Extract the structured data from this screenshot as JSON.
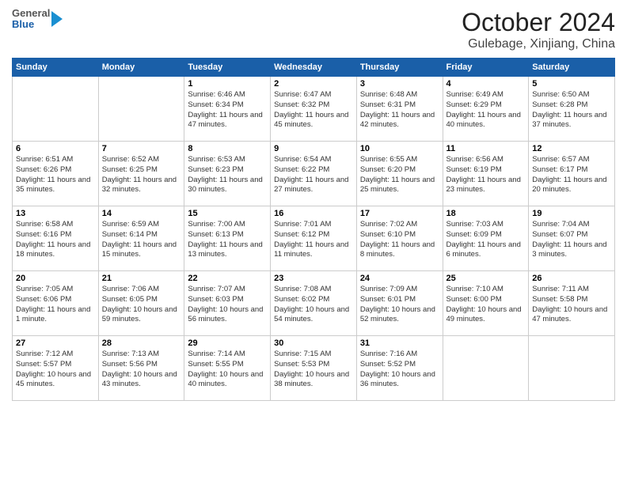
{
  "header": {
    "logo": {
      "general": "General",
      "blue": "Blue"
    },
    "title": "October 2024",
    "location": "Gulebage, Xinjiang, China"
  },
  "weekdays": [
    "Sunday",
    "Monday",
    "Tuesday",
    "Wednesday",
    "Thursday",
    "Friday",
    "Saturday"
  ],
  "weeks": [
    [
      {
        "day": "",
        "info": ""
      },
      {
        "day": "",
        "info": ""
      },
      {
        "day": "1",
        "info": "Sunrise: 6:46 AM\nSunset: 6:34 PM\nDaylight: 11 hours and 47 minutes."
      },
      {
        "day": "2",
        "info": "Sunrise: 6:47 AM\nSunset: 6:32 PM\nDaylight: 11 hours and 45 minutes."
      },
      {
        "day": "3",
        "info": "Sunrise: 6:48 AM\nSunset: 6:31 PM\nDaylight: 11 hours and 42 minutes."
      },
      {
        "day": "4",
        "info": "Sunrise: 6:49 AM\nSunset: 6:29 PM\nDaylight: 11 hours and 40 minutes."
      },
      {
        "day": "5",
        "info": "Sunrise: 6:50 AM\nSunset: 6:28 PM\nDaylight: 11 hours and 37 minutes."
      }
    ],
    [
      {
        "day": "6",
        "info": "Sunrise: 6:51 AM\nSunset: 6:26 PM\nDaylight: 11 hours and 35 minutes."
      },
      {
        "day": "7",
        "info": "Sunrise: 6:52 AM\nSunset: 6:25 PM\nDaylight: 11 hours and 32 minutes."
      },
      {
        "day": "8",
        "info": "Sunrise: 6:53 AM\nSunset: 6:23 PM\nDaylight: 11 hours and 30 minutes."
      },
      {
        "day": "9",
        "info": "Sunrise: 6:54 AM\nSunset: 6:22 PM\nDaylight: 11 hours and 27 minutes."
      },
      {
        "day": "10",
        "info": "Sunrise: 6:55 AM\nSunset: 6:20 PM\nDaylight: 11 hours and 25 minutes."
      },
      {
        "day": "11",
        "info": "Sunrise: 6:56 AM\nSunset: 6:19 PM\nDaylight: 11 hours and 23 minutes."
      },
      {
        "day": "12",
        "info": "Sunrise: 6:57 AM\nSunset: 6:17 PM\nDaylight: 11 hours and 20 minutes."
      }
    ],
    [
      {
        "day": "13",
        "info": "Sunrise: 6:58 AM\nSunset: 6:16 PM\nDaylight: 11 hours and 18 minutes."
      },
      {
        "day": "14",
        "info": "Sunrise: 6:59 AM\nSunset: 6:14 PM\nDaylight: 11 hours and 15 minutes."
      },
      {
        "day": "15",
        "info": "Sunrise: 7:00 AM\nSunset: 6:13 PM\nDaylight: 11 hours and 13 minutes."
      },
      {
        "day": "16",
        "info": "Sunrise: 7:01 AM\nSunset: 6:12 PM\nDaylight: 11 hours and 11 minutes."
      },
      {
        "day": "17",
        "info": "Sunrise: 7:02 AM\nSunset: 6:10 PM\nDaylight: 11 hours and 8 minutes."
      },
      {
        "day": "18",
        "info": "Sunrise: 7:03 AM\nSunset: 6:09 PM\nDaylight: 11 hours and 6 minutes."
      },
      {
        "day": "19",
        "info": "Sunrise: 7:04 AM\nSunset: 6:07 PM\nDaylight: 11 hours and 3 minutes."
      }
    ],
    [
      {
        "day": "20",
        "info": "Sunrise: 7:05 AM\nSunset: 6:06 PM\nDaylight: 11 hours and 1 minute."
      },
      {
        "day": "21",
        "info": "Sunrise: 7:06 AM\nSunset: 6:05 PM\nDaylight: 10 hours and 59 minutes."
      },
      {
        "day": "22",
        "info": "Sunrise: 7:07 AM\nSunset: 6:03 PM\nDaylight: 10 hours and 56 minutes."
      },
      {
        "day": "23",
        "info": "Sunrise: 7:08 AM\nSunset: 6:02 PM\nDaylight: 10 hours and 54 minutes."
      },
      {
        "day": "24",
        "info": "Sunrise: 7:09 AM\nSunset: 6:01 PM\nDaylight: 10 hours and 52 minutes."
      },
      {
        "day": "25",
        "info": "Sunrise: 7:10 AM\nSunset: 6:00 PM\nDaylight: 10 hours and 49 minutes."
      },
      {
        "day": "26",
        "info": "Sunrise: 7:11 AM\nSunset: 5:58 PM\nDaylight: 10 hours and 47 minutes."
      }
    ],
    [
      {
        "day": "27",
        "info": "Sunrise: 7:12 AM\nSunset: 5:57 PM\nDaylight: 10 hours and 45 minutes."
      },
      {
        "day": "28",
        "info": "Sunrise: 7:13 AM\nSunset: 5:56 PM\nDaylight: 10 hours and 43 minutes."
      },
      {
        "day": "29",
        "info": "Sunrise: 7:14 AM\nSunset: 5:55 PM\nDaylight: 10 hours and 40 minutes."
      },
      {
        "day": "30",
        "info": "Sunrise: 7:15 AM\nSunset: 5:53 PM\nDaylight: 10 hours and 38 minutes."
      },
      {
        "day": "31",
        "info": "Sunrise: 7:16 AM\nSunset: 5:52 PM\nDaylight: 10 hours and 36 minutes."
      },
      {
        "day": "",
        "info": ""
      },
      {
        "day": "",
        "info": ""
      }
    ]
  ]
}
